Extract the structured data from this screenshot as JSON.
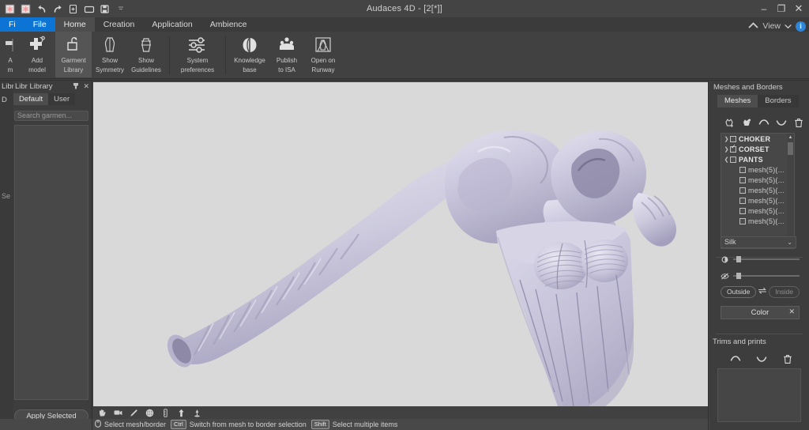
{
  "window": {
    "title": "Audaces 4D - [2[*]]",
    "controls": {
      "minimize": "–",
      "maximize": "❐",
      "close": "✕"
    }
  },
  "quick_access": [
    {
      "name": "new-snowflake-icon",
      "glyph": "snowflake"
    },
    {
      "name": "duplicate-snowflake-icon",
      "glyph": "snowflake"
    },
    {
      "name": "undo-icon",
      "glyph": "undo"
    },
    {
      "name": "redo-icon",
      "glyph": "redo"
    },
    {
      "name": "new-document-icon",
      "glyph": "new-doc"
    },
    {
      "name": "open-folder-icon",
      "glyph": "folder"
    },
    {
      "name": "save-icon",
      "glyph": "save"
    },
    {
      "name": "customize-dropdown-icon",
      "glyph": "caret"
    }
  ],
  "menubar": {
    "items": [
      {
        "label": "Fi",
        "state": "blue"
      },
      {
        "label": "File",
        "state": "blue"
      },
      {
        "label": "Home",
        "state": "active"
      },
      {
        "label": "Creation",
        "state": "normal"
      },
      {
        "label": "Application",
        "state": "normal"
      },
      {
        "label": "Ambience",
        "state": "normal"
      }
    ],
    "view_label": "View"
  },
  "ribbon": {
    "buttons": [
      {
        "label_line1": "A",
        "label_line2": "m",
        "icon": "avatar-icon",
        "active": false,
        "clipped": true
      },
      {
        "label_line1": "Add",
        "label_line2": "model",
        "icon": "add-model-icon",
        "active": false
      },
      {
        "label_line1": "Garment",
        "label_line2": "Library",
        "icon": "garment-library-icon",
        "active": true
      },
      {
        "label_line1": "Show",
        "label_line2": "Symmetry",
        "icon": "symmetry-icon",
        "active": false
      },
      {
        "label_line1": "Show",
        "label_line2": "Guidelines",
        "icon": "guidelines-icon",
        "active": false
      },
      {
        "label_line1": "System",
        "label_line2": "preferences",
        "icon": "preferences-icon",
        "active": false
      },
      {
        "label_line1": "Knowledge",
        "label_line2": "base",
        "icon": "knowledge-base-icon",
        "active": false
      },
      {
        "label_line1": "Publish",
        "label_line2": "to ISA",
        "icon": "publish-icon",
        "active": false
      },
      {
        "label_line1": "Open on",
        "label_line2": "Runway",
        "icon": "runway-icon",
        "active": false
      }
    ]
  },
  "left_panel": {
    "title": "Libr Library",
    "title_ghost": "Libr",
    "pin_icon": "pin-icon",
    "close_icon": "close-icon",
    "tabs": [
      {
        "label": "D",
        "active": false
      },
      {
        "label": "Default",
        "active": true
      },
      {
        "label": "User",
        "active": false
      }
    ],
    "search_placeholder": "Search garmen...",
    "search_ghost": "Se",
    "apply_button": "Apply Selected"
  },
  "viewport": {
    "background": "#d9d9d9",
    "garment_color": "#c2bfd6",
    "toolbar_icons": [
      {
        "name": "hand-pan-icon"
      },
      {
        "name": "camera-icon"
      },
      {
        "name": "pen-icon"
      },
      {
        "name": "globe-rotate-icon"
      },
      {
        "name": "ruler-icon"
      },
      {
        "name": "up-arrow-icon"
      },
      {
        "name": "pin-drop-icon"
      }
    ]
  },
  "statusbar": {
    "hints": [
      {
        "key": "mouse-icon",
        "key_is_icon": true,
        "text": "Select mesh/border"
      },
      {
        "key": "Ctrl",
        "key_is_icon": false,
        "text": "Switch from mesh to border selection"
      },
      {
        "key": "Shift",
        "key_is_icon": false,
        "text": "Select multiple items"
      }
    ]
  },
  "right_panel": {
    "title": "Meshes and Borders",
    "tabs": [
      {
        "label": "Meshes",
        "active": true
      },
      {
        "label": "Borders",
        "active": false
      }
    ],
    "toolbar_icons": [
      {
        "name": "add-mesh-icon"
      },
      {
        "name": "duplicate-mesh-icon"
      },
      {
        "name": "move-up-icon"
      },
      {
        "name": "move-down-icon"
      },
      {
        "name": "delete-icon"
      }
    ],
    "tree": [
      {
        "label": "CHOKER",
        "checked": false,
        "expanded": false,
        "child": false,
        "has_arrow": true
      },
      {
        "label": "CORSET",
        "checked": true,
        "expanded": false,
        "child": false,
        "has_arrow": true
      },
      {
        "label": "PANTS",
        "checked": false,
        "expanded": true,
        "child": false,
        "has_arrow": true
      },
      {
        "label": "mesh(5)(...",
        "checked": false,
        "child": true,
        "has_arrow": false
      },
      {
        "label": "mesh(5)(...",
        "checked": false,
        "child": true,
        "has_arrow": false
      },
      {
        "label": "mesh(5)(...",
        "checked": false,
        "child": true,
        "has_arrow": false
      },
      {
        "label": "mesh(5)(...",
        "checked": false,
        "child": true,
        "has_arrow": false
      },
      {
        "label": "mesh(5)(...",
        "checked": false,
        "child": true,
        "has_arrow": false
      },
      {
        "label": "mesh(5)(...",
        "checked": false,
        "child": true,
        "has_arrow": false
      }
    ],
    "material": {
      "selected": "Silk",
      "slider_brightness": {
        "icon": "brightness-icon",
        "value": 8
      },
      "slider_transparency": {
        "icon": "eye-hidden-icon",
        "value": 8
      },
      "side_outside": "Outside",
      "side_inside": "Inside",
      "side_swap_icon": "swap-side-icon",
      "color_label": "Color",
      "color_close": "✕"
    },
    "trims": {
      "title": "Trims and prints",
      "icons": [
        {
          "name": "move-up-icon"
        },
        {
          "name": "move-down-icon"
        },
        {
          "name": "delete-icon"
        }
      ]
    }
  }
}
